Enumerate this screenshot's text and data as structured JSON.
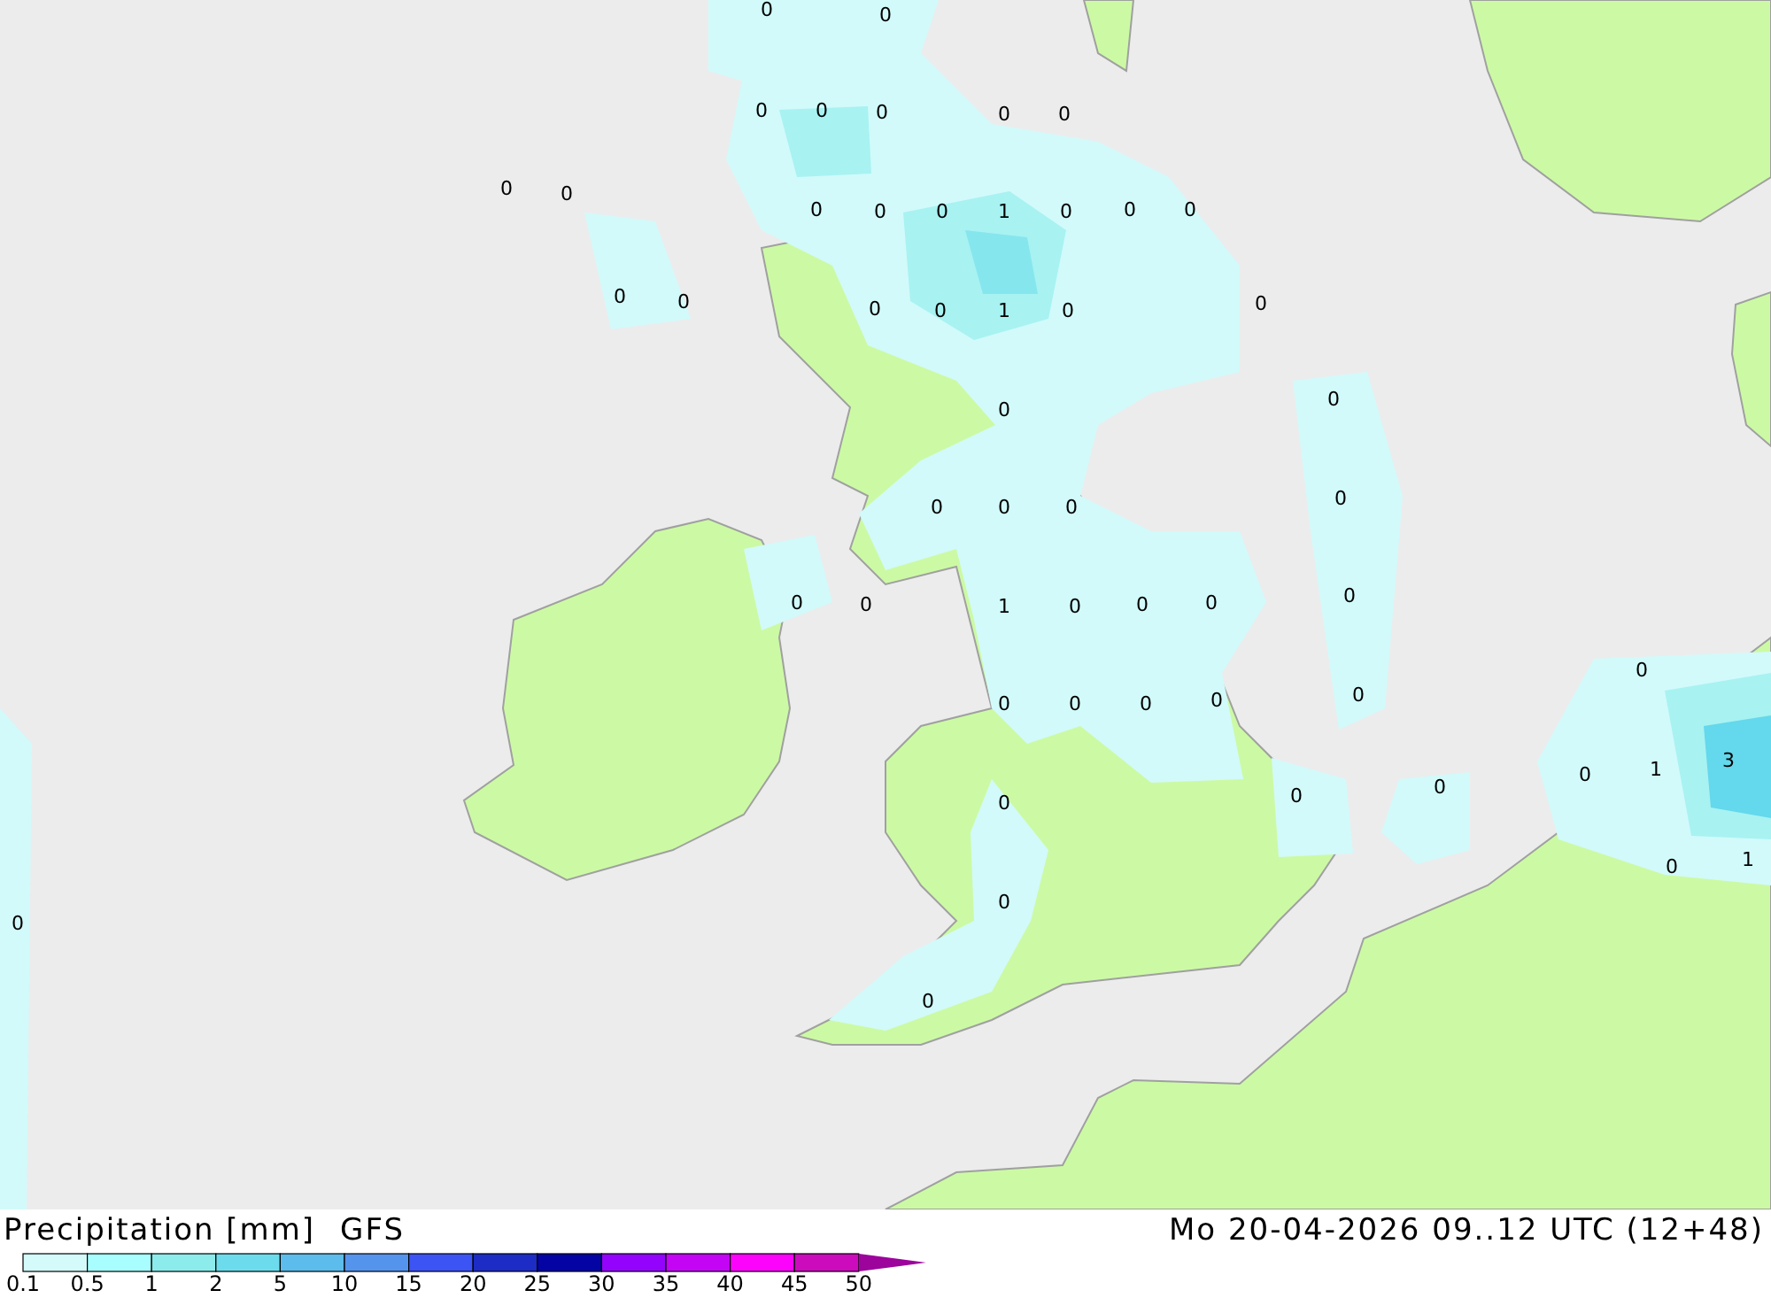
{
  "map": {
    "labels": [
      "0",
      "0",
      "0",
      "0",
      "0",
      "0",
      "0",
      "0",
      "0",
      "0",
      "0",
      "0",
      "1",
      "0",
      "0",
      "0",
      "0",
      "0",
      "0",
      "0",
      "1",
      "0",
      "0",
      "0",
      "0",
      "0",
      "0",
      "0",
      "0",
      "0",
      "0",
      "0",
      "1",
      "0",
      "0",
      "0",
      "0",
      "0",
      "0",
      "0",
      "0",
      "0",
      "0",
      "1",
      "3",
      "0",
      "0",
      "0",
      "1",
      "0",
      "0",
      "0",
      "0"
    ]
  },
  "footer": {
    "title": "Precipitation [mm]",
    "model": "GFS",
    "date": "Mo 20-04-2026 09..12 UTC (12+48)"
  },
  "legend": {
    "swatches": [
      {
        "kind": "box",
        "color": "#d4fafa"
      },
      {
        "kind": "box",
        "color": "#a8fefe"
      },
      {
        "kind": "box",
        "color": "#8cecec"
      },
      {
        "kind": "box",
        "color": "#6cdcec"
      },
      {
        "kind": "box",
        "color": "#5cbcec"
      },
      {
        "kind": "box",
        "color": "#5494ec"
      },
      {
        "kind": "box",
        "color": "#3c54f4"
      },
      {
        "kind": "box",
        "color": "#1c2cc4"
      },
      {
        "kind": "box",
        "color": "#0404a4"
      },
      {
        "kind": "box",
        "color": "#9404fc"
      },
      {
        "kind": "box",
        "color": "#c404f4"
      },
      {
        "kind": "box",
        "color": "#fc04fc"
      },
      {
        "kind": "box",
        "color": "#cc0cbc"
      },
      {
        "kind": "arrow",
        "color": "#9c049c"
      }
    ],
    "ticks": [
      "0.1",
      "0.5",
      "1",
      "2",
      "5",
      "10",
      "15",
      "20",
      "25",
      "30",
      "35",
      "40",
      "45",
      "50"
    ]
  }
}
